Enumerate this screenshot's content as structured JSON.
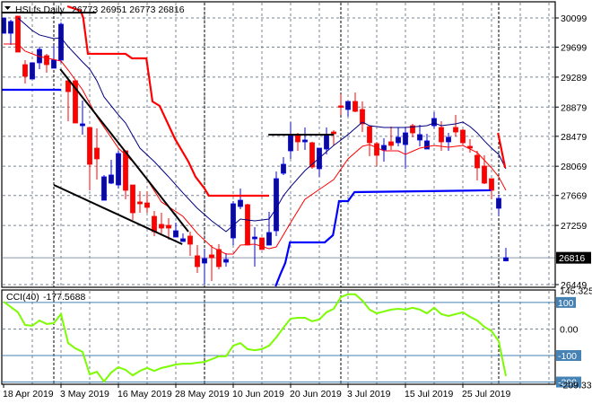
{
  "chart_title": {
    "symbol_timeframe": "HSI.fs,Daily",
    "ohlc": "26773 26951 26773 26816"
  },
  "cci_label": {
    "name": "CCI(40)",
    "value": "-177.5688"
  },
  "current_price_label": "26816",
  "colors": {
    "bull_fill": "#0a0aa0",
    "bull_line": "#0000ff",
    "bear": "#ff0000",
    "cci": "#7cfc00",
    "level": "#4682b4",
    "grid": "#7a8594",
    "fast_ma": "#ff0000",
    "slow_ma": "#000080",
    "upper_channel": "#ff0000",
    "lower_channel": "#0000ff",
    "trendline": "#000000"
  },
  "chart_data": [
    {
      "type": "candlestick",
      "title": "HSI.fs,Daily",
      "y_range": [
        26449,
        30099
      ],
      "y_ticks": [
        30099,
        29699,
        29289,
        28879,
        28479,
        28069,
        27669,
        27259,
        26449
      ],
      "current_price": 26816,
      "x_labels": [
        {
          "bar": 1,
          "text": "18 Apr 2019"
        },
        {
          "bar": 9,
          "text": "3 May 2019"
        },
        {
          "bar": 17,
          "text": "16 May 2019"
        },
        {
          "bar": 25,
          "text": "28 May 2019"
        },
        {
          "bar": 33,
          "text": "10 Jun 2019"
        },
        {
          "bar": 41,
          "text": "20 Jun 2019"
        },
        {
          "bar": 49,
          "text": "3 Jul 2019"
        },
        {
          "bar": 57,
          "text": "15 Jul 2019"
        },
        {
          "bar": 65,
          "text": "25 Jul 2019"
        }
      ],
      "period_separators": [
        8,
        29,
        48,
        70
      ],
      "ohlc": [
        [
          29890,
          30099,
          29890,
          30099
        ],
        [
          29890,
          30075,
          29730,
          30050
        ],
        [
          30124,
          30124,
          29632,
          29632
        ],
        [
          29460,
          29522,
          29202,
          29300
        ],
        [
          29263,
          29485,
          29263,
          29485
        ],
        [
          29485,
          29706,
          29399,
          29669
        ],
        [
          29583,
          29608,
          29350,
          29460
        ],
        [
          29411,
          29730,
          29411,
          29522
        ],
        [
          29522,
          30038,
          29485,
          30013
        ],
        [
          29239,
          29263,
          28686,
          29091
        ],
        [
          29239,
          29239,
          28661,
          28661
        ],
        [
          28624,
          28968,
          28502,
          28649
        ],
        [
          28600,
          28600,
          27740,
          28096
        ],
        [
          28317,
          28588,
          27887,
          28170
        ],
        [
          27604,
          27949,
          27604,
          27924
        ],
        [
          27838,
          28157,
          27826,
          27949
        ],
        [
          27813,
          28280,
          27764,
          28243
        ],
        [
          28280,
          28280,
          27617,
          27740
        ],
        [
          27813,
          27813,
          27334,
          27432
        ],
        [
          27580,
          27727,
          27432,
          27555
        ],
        [
          27567,
          27727,
          27432,
          27506
        ],
        [
          27383,
          27457,
          27113,
          27174
        ],
        [
          27273,
          27432,
          27150,
          27223
        ],
        [
          27260,
          27358,
          27064,
          27223
        ],
        [
          27100,
          27297,
          27100,
          27186
        ],
        [
          27039,
          27150,
          27039,
          27076
        ],
        [
          27113,
          27174,
          26843,
          27002
        ],
        [
          26843,
          26990,
          26609,
          26695
        ],
        [
          26744,
          26941,
          26449,
          26805
        ],
        [
          26855,
          26990,
          26498,
          26817
        ],
        [
          26929,
          27002,
          26658,
          26695
        ],
        [
          26756,
          26879,
          26695,
          26793
        ],
        [
          27088,
          27592,
          26990,
          27555
        ],
        [
          27518,
          27764,
          27481,
          27604
        ],
        [
          27543,
          27555,
          26990,
          26990
        ],
        [
          27076,
          27236,
          26695,
          27100
        ],
        [
          27088,
          27088,
          26929,
          26929
        ],
        [
          26990,
          27445,
          26990,
          27162
        ],
        [
          27186,
          27998,
          27113,
          27899
        ],
        [
          27973,
          28194,
          27949,
          28096
        ],
        [
          28280,
          28674,
          28170,
          28502
        ],
        [
          28489,
          28526,
          28280,
          28403
        ],
        [
          28403,
          28600,
          28293,
          28428
        ],
        [
          28391,
          28403,
          28035,
          28059
        ],
        [
          28035,
          28317,
          27924,
          28317
        ],
        [
          28305,
          28600,
          28231,
          28502
        ],
        [
          28538,
          28563,
          28354,
          28514
        ],
        [
          28895,
          29055,
          28772,
          28883
        ],
        [
          28846,
          28956,
          28748,
          28956
        ],
        [
          28956,
          29079,
          28809,
          28821
        ],
        [
          28846,
          28956,
          28538,
          28649
        ],
        [
          28612,
          28624,
          28207,
          28391
        ],
        [
          28379,
          28403,
          28071,
          28219
        ],
        [
          28293,
          28452,
          28133,
          28354
        ],
        [
          28403,
          28612,
          28293,
          28354
        ],
        [
          28391,
          28600,
          28342,
          28465
        ],
        [
          28366,
          28600,
          28035,
          28526
        ],
        [
          28624,
          28649,
          28465,
          28526
        ],
        [
          28428,
          28637,
          28342,
          28502
        ],
        [
          28305,
          28514,
          28305,
          28416
        ],
        [
          28624,
          28809,
          28588,
          28723
        ],
        [
          28600,
          28686,
          28280,
          28403
        ],
        [
          28403,
          28526,
          28280,
          28465
        ],
        [
          28600,
          28772,
          28477,
          28538
        ],
        [
          28563,
          28575,
          28366,
          28391
        ],
        [
          28342,
          28440,
          28256,
          28317
        ],
        [
          28219,
          28280,
          27875,
          28047
        ],
        [
          28071,
          28219,
          27826,
          27838
        ],
        [
          27899,
          27899,
          27617,
          27740
        ],
        [
          27494,
          27678,
          27383,
          27629
        ],
        [
          26773,
          26951,
          26773,
          26816
        ]
      ],
      "lines": [
        {
          "name": "fast-ma",
          "color_key": "fast_ma",
          "width": 1,
          "points": [
            [
              1,
              29743
            ],
            [
              3,
              29743
            ],
            [
              4,
              29645
            ],
            [
              6,
              29571
            ],
            [
              9,
              29509
            ],
            [
              10,
              29386
            ],
            [
              12,
              29116
            ],
            [
              14,
              28748
            ],
            [
              17,
              28317
            ],
            [
              19,
              28133
            ],
            [
              21,
              27887
            ],
            [
              23,
              27580
            ],
            [
              26,
              27383
            ],
            [
              28,
              27150
            ],
            [
              30,
              26965
            ],
            [
              32,
              26867
            ],
            [
              33,
              26867
            ],
            [
              34,
              26990
            ],
            [
              36,
              27002
            ],
            [
              38,
              26941
            ],
            [
              39,
              26965
            ],
            [
              41,
              27297
            ],
            [
              43,
              27617
            ],
            [
              45,
              27752
            ],
            [
              47,
              27887
            ],
            [
              49,
              28170
            ],
            [
              51,
              28342
            ],
            [
              52,
              28366
            ],
            [
              54,
              28280
            ],
            [
              56,
              28280
            ],
            [
              57,
              28231
            ],
            [
              59,
              28317
            ],
            [
              61,
              28354
            ],
            [
              63,
              28330
            ],
            [
              65,
              28354
            ],
            [
              67,
              28256
            ],
            [
              69,
              28047
            ],
            [
              70,
              27924
            ],
            [
              71,
              27740
            ]
          ]
        },
        {
          "name": "slow-ma",
          "color_key": "slow_ma",
          "width": 1,
          "points": [
            [
              3,
              30099
            ],
            [
              4,
              30013
            ],
            [
              5,
              29927
            ],
            [
              6,
              29866
            ],
            [
              8,
              29817
            ],
            [
              9,
              29829
            ],
            [
              10,
              29706
            ],
            [
              12,
              29497
            ],
            [
              13,
              29399
            ],
            [
              14,
              29239
            ],
            [
              15,
              29018
            ],
            [
              17,
              28772
            ],
            [
              18,
              28661
            ],
            [
              20,
              28317
            ],
            [
              22,
              28133
            ],
            [
              24,
              27924
            ],
            [
              26,
              27703
            ],
            [
              28,
              27494
            ],
            [
              30,
              27321
            ],
            [
              32,
              27174
            ],
            [
              33,
              27260
            ],
            [
              34,
              27346
            ],
            [
              36,
              27321
            ],
            [
              38,
              27346
            ],
            [
              39,
              27494
            ],
            [
              40,
              27666
            ],
            [
              41,
              27789
            ],
            [
              43,
              28010
            ],
            [
              45,
              28182
            ],
            [
              47,
              28354
            ],
            [
              49,
              28502
            ],
            [
              51,
              28674
            ],
            [
              52,
              28624
            ],
            [
              54,
              28600
            ],
            [
              57,
              28600
            ],
            [
              60,
              28624
            ],
            [
              61,
              28661
            ],
            [
              62,
              28624
            ],
            [
              64,
              28649
            ],
            [
              65,
              28674
            ],
            [
              66,
              28612
            ],
            [
              67,
              28526
            ],
            [
              68,
              28416
            ],
            [
              69,
              28317
            ],
            [
              70,
              28231
            ],
            [
              71,
              28035
            ]
          ]
        },
        {
          "name": "upper-channel",
          "color_key": "upper_channel",
          "width": 2.2,
          "points": [
            [
              9.9,
              30259
            ],
            [
              11.75,
              30197
            ],
            [
              12.1,
              30099
            ],
            [
              12.75,
              29608
            ],
            [
              18,
              29608
            ],
            [
              18.9,
              29546
            ],
            [
              20.9,
              29546
            ],
            [
              21.75,
              28956
            ],
            [
              22.75,
              28895
            ],
            [
              24.9,
              28440
            ],
            [
              26.75,
              28133
            ],
            [
              27.75,
              27924
            ],
            [
              29,
              27764
            ],
            [
              29.6,
              27666
            ],
            [
              38,
              27666
            ]
          ]
        },
        {
          "name": "upper-channel-recent",
          "color_key": "upper_channel",
          "width": 2.2,
          "points": [
            [
              69.9,
              28526
            ],
            [
              70.9,
              28047
            ]
          ]
        },
        {
          "name": "lower-channel",
          "color_key": "lower_channel",
          "width": 2.2,
          "points": [
            [
              0.75,
              29116
            ],
            [
              9,
              29116
            ]
          ]
        },
        {
          "name": "lower-channel-recent",
          "color_key": "lower_channel",
          "width": 2.2,
          "points": [
            [
              38.9,
              26425
            ],
            [
              39.6,
              26597
            ],
            [
              40.25,
              26744
            ],
            [
              40.9,
              27027
            ],
            [
              45.75,
              27027
            ],
            [
              46.9,
              27125
            ],
            [
              47.4,
              27395
            ],
            [
              47.75,
              27592
            ],
            [
              49,
              27592
            ],
            [
              49.9,
              27715
            ],
            [
              68.9,
              27740
            ]
          ]
        },
        {
          "name": "top-trendline",
          "color_key": "trendline",
          "width": 2,
          "points": [
            [
              0.75,
              30173
            ],
            [
              13.9,
              30173
            ]
          ]
        },
        {
          "name": "falling-upper-trendline",
          "color_key": "trendline",
          "width": 2,
          "points": [
            [
              8.9,
              29399
            ],
            [
              26.75,
              27174
            ]
          ]
        },
        {
          "name": "falling-lower-trendline",
          "color_key": "trendline",
          "width": 2,
          "points": [
            [
              8,
              27813
            ],
            [
              25.9,
              27002
            ]
          ]
        },
        {
          "name": "resistance-trendline",
          "color_key": "trendline",
          "width": 2,
          "points": [
            [
              37.9,
              28502
            ],
            [
              47,
              28502
            ]
          ]
        }
      ]
    },
    {
      "type": "line",
      "title": "CCI(40)",
      "ylim": [
        -209.332,
        145.3253
      ],
      "y_ticks": [
        {
          "value": 145.3253,
          "label": "145.3253",
          "boxed": false
        },
        {
          "value": 100,
          "label": "100",
          "boxed": true
        },
        {
          "value": 0,
          "label": "0.00",
          "boxed": false
        },
        {
          "value": -100,
          "label": "-100",
          "boxed": true
        },
        {
          "value": -200,
          "label": "-200",
          "boxed": true
        },
        {
          "value": -209.332,
          "label": "-209.332",
          "boxed": false
        }
      ],
      "levels": [
        100,
        -100,
        -200
      ],
      "values": [
        103,
        83,
        63,
        15,
        12,
        32,
        19,
        22,
        56,
        -53,
        -73,
        -86,
        -171,
        -161,
        -198,
        -164,
        -144,
        -154,
        -175,
        -158,
        -147,
        -158,
        -147,
        -141,
        -134,
        -131,
        -131,
        -127,
        -124,
        -114,
        -103,
        -103,
        -63,
        -53,
        -76,
        -80,
        -76,
        -63,
        -32,
        5,
        39,
        42,
        42,
        29,
        36,
        63,
        76,
        120,
        131,
        131,
        107,
        73,
        59,
        66,
        73,
        76,
        73,
        80,
        73,
        59,
        80,
        56,
        49,
        56,
        63,
        46,
        32,
        8,
        -8,
        -46,
        -177.5688
      ]
    }
  ]
}
